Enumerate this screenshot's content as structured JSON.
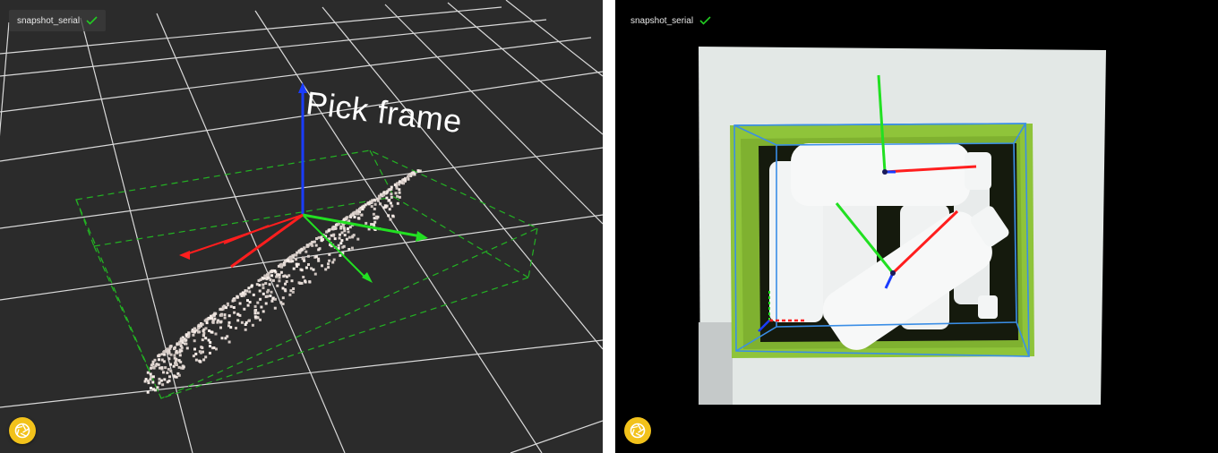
{
  "left_view": {
    "snapshot_label": "snapshot_serial",
    "status_icon": "check-icon",
    "frame_label": "Pick frame",
    "capture_button_icon": "camera-shutter-icon"
  },
  "right_view": {
    "snapshot_label": "snapshot_serial",
    "status_icon": "check-icon",
    "capture_button_icon": "camera-shutter-icon"
  },
  "colors": {
    "axis_x": "#ff1e1e",
    "axis_y": "#22e022",
    "axis_z": "#1a3cff",
    "bbox_dashed": "#23b323",
    "bbox_blue": "#3a8ee6",
    "crate": "#8fc43a",
    "capture_button": "#f2c21b"
  }
}
